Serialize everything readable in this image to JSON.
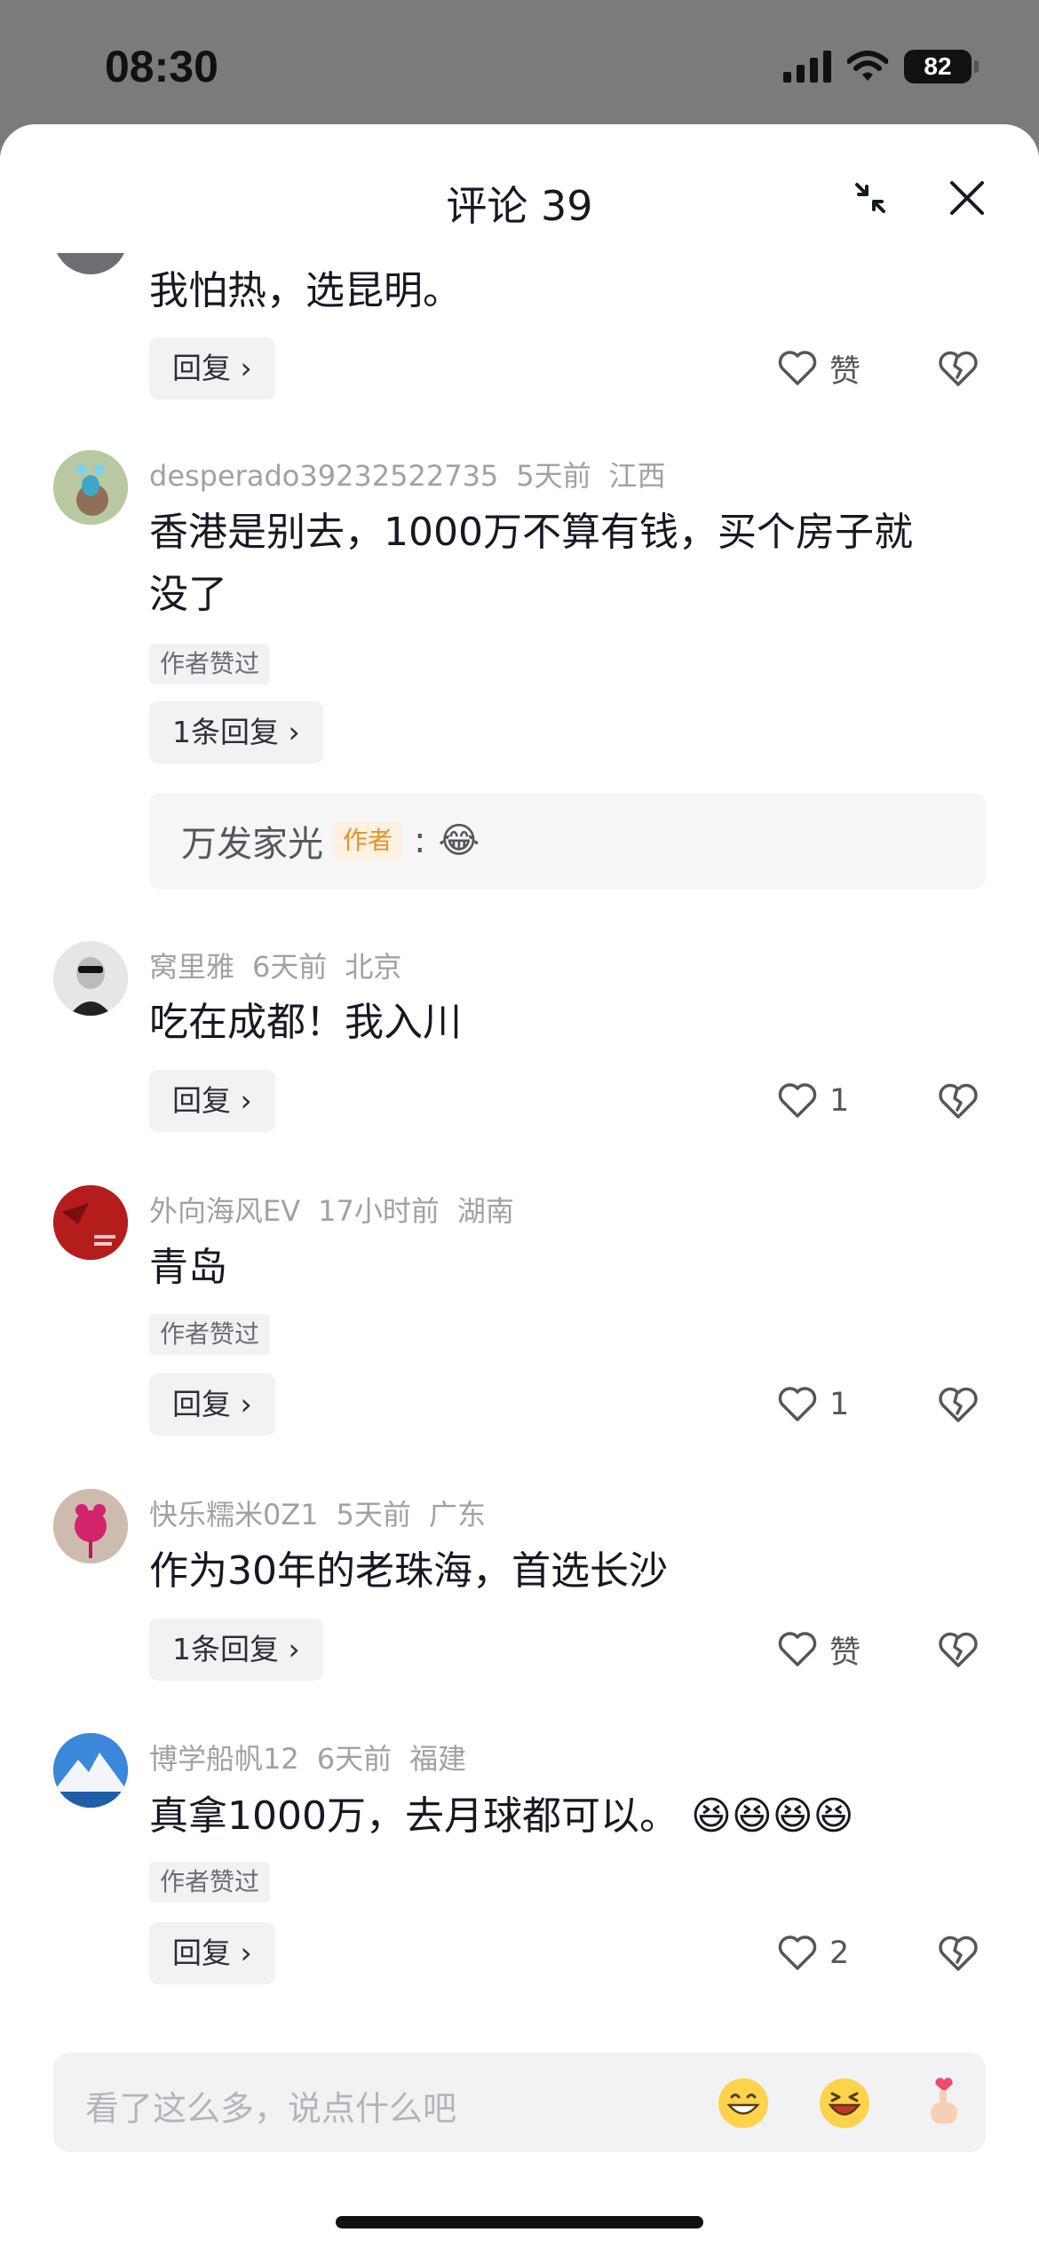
{
  "status_bar": {
    "time": "08:30",
    "battery": "82"
  },
  "header": {
    "title": "评论 39"
  },
  "comments": [
    {
      "text": "我怕热，选昆明。",
      "reply_label": "回复",
      "like_label": "赞"
    },
    {
      "username": "desperado39232522735",
      "time": "5天前",
      "location": "江西",
      "text_line1": "香港是别去，1000万不算有钱，买个房子就",
      "text_line2": "没了",
      "author_liked": "作者赞过",
      "reply_label": "1条回复",
      "reply_preview": {
        "name": "万发家光",
        "tag": "作者",
        "content": "😂"
      }
    },
    {
      "username": "窝里雅",
      "time": "6天前",
      "location": "北京",
      "text": "吃在成都！我入川",
      "reply_label": "回复",
      "like_count": "1"
    },
    {
      "username": "外向海风EV",
      "time": "17小时前",
      "location": "湖南",
      "text": "青岛",
      "author_liked": "作者赞过",
      "reply_label": "回复",
      "like_count": "1"
    },
    {
      "username": "快乐糯米0Z1",
      "time": "5天前",
      "location": "广东",
      "text": "作为30年的老珠海，首选长沙",
      "reply_label": "1条回复",
      "like_label": "赞"
    },
    {
      "username": "博学船帆12",
      "time": "6天前",
      "location": "福建",
      "text": "真拿1000万，去月球都可以。",
      "author_liked": "作者赞过",
      "reply_label": "回复",
      "like_count": "2"
    }
  ],
  "input": {
    "placeholder": "看了这么多，说点什么吧"
  },
  "colors": {
    "sheet": "#ffffff",
    "muted_text": "#a0a1a6",
    "author_tag": "#e7912a",
    "pill_bg": "#f2f2f4"
  }
}
